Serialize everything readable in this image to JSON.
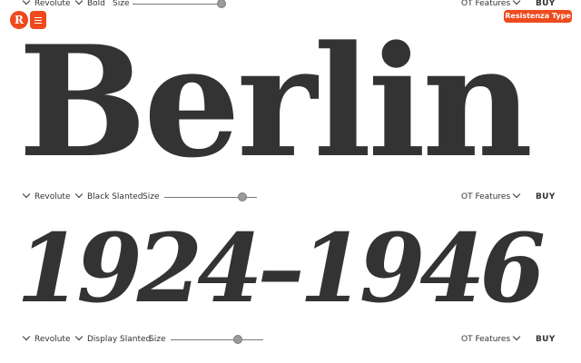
{
  "brand": {
    "logo_glyph": "R",
    "name": "Resistenza Type",
    "accent": "#ee4a1d"
  },
  "rows": [
    {
      "family": "Revolute",
      "style": "Bold",
      "size_label": "Size",
      "size_level": 1.0,
      "features": "OT Features",
      "buy": "BUY",
      "specimen": "Berlin"
    },
    {
      "family": "Revolute",
      "style": "Black Slanted",
      "size_label": "Size",
      "size_level": 0.83,
      "features": "OT Features",
      "buy": "BUY",
      "specimen": "1924–1946"
    },
    {
      "family": "Revolute",
      "style": "Display Slanted",
      "size_label": "Size",
      "size_level": 0.7,
      "features": "OT Features",
      "buy": "BUY"
    }
  ],
  "icons": {
    "menu": "hamburger-icon",
    "chevron": "chevron-down-icon"
  },
  "colors": {
    "text": "#333333",
    "background": "#ffffff"
  }
}
